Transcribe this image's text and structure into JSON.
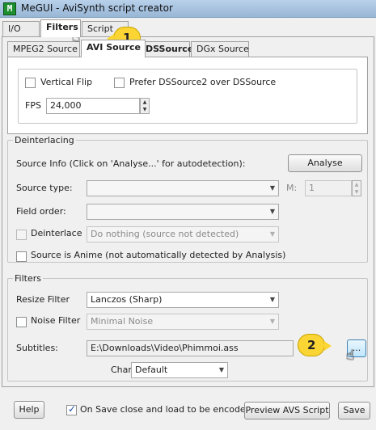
{
  "window": {
    "title": "MeGUI - AviSynth script creator",
    "icon_letter": "M"
  },
  "main_tabs": [
    {
      "label": "I/O"
    },
    {
      "label": "Filters",
      "active": true
    },
    {
      "label": "Script"
    }
  ],
  "source_tabs": [
    {
      "label": "MPEG2 Source"
    },
    {
      "label": "AVI Source",
      "active": true
    },
    {
      "label": "DSSource"
    },
    {
      "label": "DGx Source"
    }
  ],
  "source": {
    "vertical_flip_label": "Vertical Flip",
    "vertical_flip_checked": false,
    "prefer_dss2_label": "Prefer DSSource2 over DSSource",
    "prefer_dss2_checked": false,
    "fps_label": "FPS",
    "fps_value": "24,000"
  },
  "deinterlacing": {
    "group_label": "Deinterlacing",
    "source_info_label": "Source Info (Click on 'Analyse...' for autodetection):",
    "analyse_button": "Analyse",
    "source_type_label": "Source type:",
    "source_type_value": "",
    "m_label": "M:",
    "m_value": "1",
    "field_order_label": "Field order:",
    "field_order_value": "",
    "deinterlace_label": "Deinterlace",
    "deinterlace_checked": false,
    "deinterlace_value": "Do nothing (source not detected)",
    "anime_label": "Source is Anime (not automatically detected by Analysis)",
    "anime_checked": false
  },
  "filters": {
    "group_label": "Filters",
    "resize_label": "Resize Filter",
    "resize_value": "Lanczos (Sharp)",
    "noise_label": "Noise Filter",
    "noise_checked": false,
    "noise_value": "Minimal Noise",
    "subtitles_label": "Subtitles:",
    "subtitles_value": "E:\\Downloads\\Video\\Phimmoi.ass",
    "browse_button": "...",
    "charset_label": "Charset:",
    "charset_value": "Default"
  },
  "bottom": {
    "help_button": "Help",
    "on_save_label": "On Save close and load to be encoded",
    "on_save_checked": true,
    "preview_button": "Preview AVS Script",
    "save_button": "Save"
  },
  "callouts": {
    "one": "1",
    "two": "2"
  },
  "icons": {
    "dropdown": "chevron-down-icon",
    "spin_up": "spin-up-icon",
    "spin_down": "spin-down-icon",
    "cursor": "hand-cursor-icon"
  }
}
